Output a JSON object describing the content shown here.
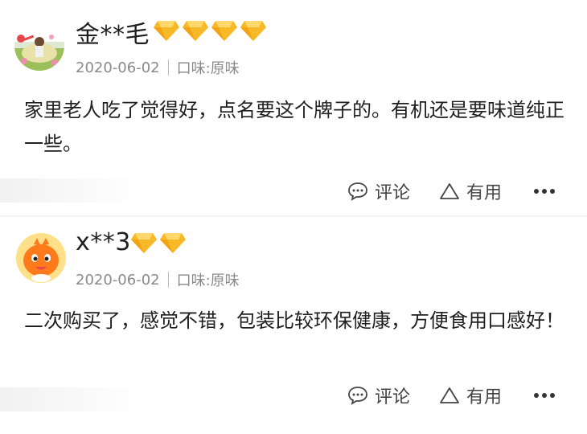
{
  "reviews": [
    {
      "username": "金**毛",
      "diamond_count": 4,
      "date": "2020-06-02",
      "flavor": "口味:原味",
      "content": "家里老人吃了觉得好，点名要这个牌子的。有机还是要味道纯正一些。",
      "comment_label": "评论",
      "useful_label": "有用",
      "avatar_icon": "photo-avatar-icon"
    },
    {
      "username": "x**3",
      "diamond_count": 2,
      "date": "2020-06-02",
      "flavor": "口味:原味",
      "content": "二次购买了，感觉不错，包装比较环保健康，方便食用口感好！",
      "comment_label": "评论",
      "useful_label": "有用",
      "avatar_icon": "orange-mascot-avatar-icon"
    }
  ],
  "colors": {
    "diamond_gold": "#f7b928",
    "diamond_light": "#ffd86b",
    "mascot_orange": "#ff7a1a",
    "meta_gray": "#8a8a8a"
  }
}
